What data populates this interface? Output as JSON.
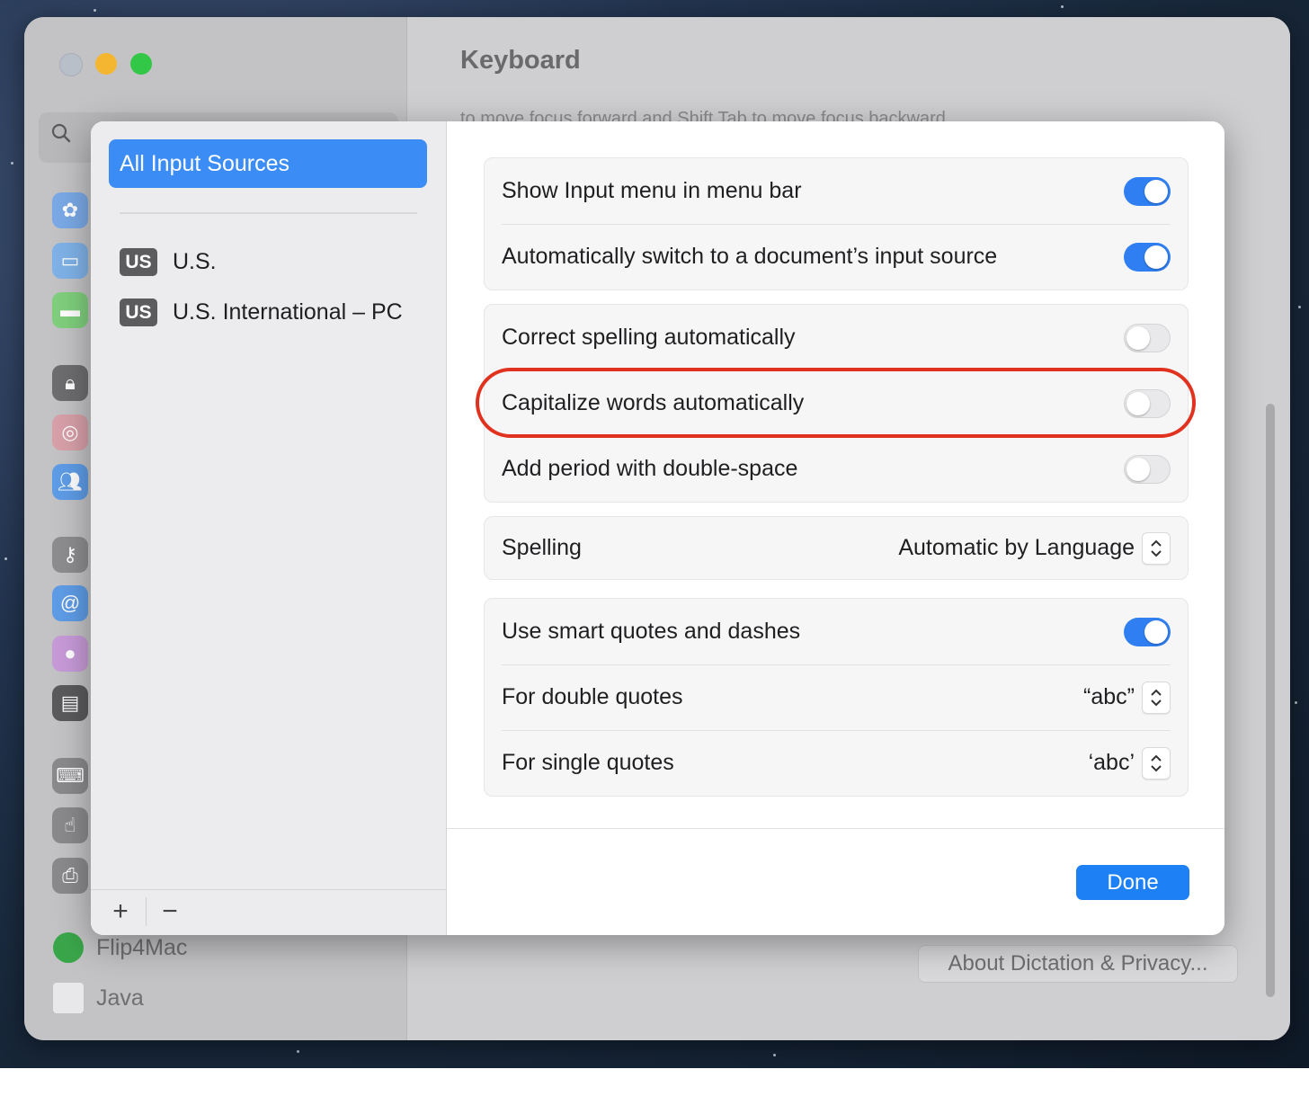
{
  "background_window": {
    "title": "Keyboard",
    "cut_off_text": "to move focus forward and Shift Tab to move focus backward",
    "apps": [
      {
        "name": "Flip4Mac"
      },
      {
        "name": "Java"
      }
    ],
    "about_button": "About Dictation & Privacy..."
  },
  "sheet": {
    "left": {
      "selected": "All Input Sources",
      "sources": [
        {
          "badge": "US",
          "name": "U.S."
        },
        {
          "badge": "US",
          "name": "U.S. International – PC"
        }
      ],
      "add_label": "+",
      "remove_label": "−"
    },
    "groups": [
      {
        "rows": [
          {
            "label": "Show Input menu in menu bar",
            "type": "toggle",
            "value": true
          },
          {
            "label": "Automatically switch to a document’s input source",
            "type": "toggle",
            "value": true
          }
        ]
      },
      {
        "rows": [
          {
            "label": "Correct spelling automatically",
            "type": "toggle",
            "value": false
          },
          {
            "label": "Capitalize words automatically",
            "type": "toggle",
            "value": false
          },
          {
            "label": "Add period with double-space",
            "type": "toggle",
            "value": false
          }
        ]
      },
      {
        "rows": [
          {
            "label": "Spelling",
            "type": "popup",
            "value": "Automatic by Language"
          }
        ]
      },
      {
        "rows": [
          {
            "label": "Use smart quotes and dashes",
            "type": "toggle",
            "value": true
          },
          {
            "label": "For double quotes",
            "type": "popup",
            "value": "“abc”"
          },
          {
            "label": "For single quotes",
            "type": "popup",
            "value": "‘abc’"
          }
        ]
      }
    ],
    "done_label": "Done"
  },
  "colors": {
    "accent": "#2f7ff2",
    "selection": "#3b8cf5",
    "highlight": "#e0321e"
  }
}
